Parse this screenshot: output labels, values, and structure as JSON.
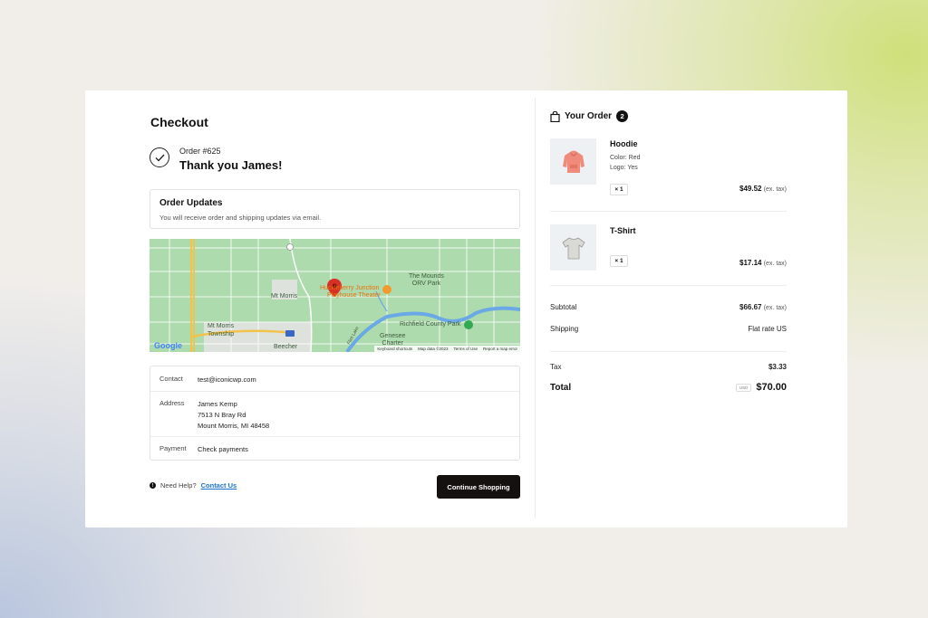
{
  "checkout": {
    "title": "Checkout",
    "order_number": "Order #625",
    "thank_you": "Thank you James!"
  },
  "updates": {
    "heading": "Order Updates",
    "text": "You will receive order and shipping updates via email."
  },
  "map": {
    "labels": {
      "mt_morris": "Mt Morris",
      "mt_morris_township": "Mt Morris Township",
      "beecher": "Beecher",
      "theater_line1": "Huckleberry Junction",
      "theater_line2": "Playhouse Theater",
      "mounds_line1": "The Mounds",
      "mounds_line2": "ORV Park",
      "richfield": "Richfield County Park",
      "genesee_line1": "Genesee",
      "genesee_line2": "Charter",
      "flint_lake": "Flint Lake"
    },
    "google": "Google",
    "attribution": {
      "shortcuts": "Keyboard shortcuts",
      "map_data": "Map data ©2023",
      "terms": "Terms of Use",
      "report": "Report a map error"
    }
  },
  "details": {
    "contact_label": "Contact",
    "contact_value": "test@iconicwp.com",
    "address_label": "Address",
    "address_line1": "James Kemp",
    "address_line2": "7513 N Bray Rd",
    "address_line3": "Mount Morris, MI 48458",
    "payment_label": "Payment",
    "payment_value": "Check payments"
  },
  "help": {
    "text": "Need Help?",
    "link": "Contact Us"
  },
  "continue_button": "Continue Shopping",
  "order": {
    "title": "Your Order",
    "count": "2",
    "items": [
      {
        "name": "Hoodie",
        "meta1": "Color: Red",
        "meta2": "Logo: Yes",
        "qty": "× 1",
        "price": "$49.52",
        "ex_tax": "(ex. tax)"
      },
      {
        "name": "T-Shirt",
        "qty": "× 1",
        "price": "$17.14",
        "ex_tax": "(ex. tax)"
      }
    ],
    "subtotal_label": "Subtotal",
    "subtotal_value": "$66.67",
    "subtotal_ex": "(ex. tax)",
    "shipping_label": "Shipping",
    "shipping_value": "Flat rate US",
    "tax_label": "Tax",
    "tax_value": "$3.33",
    "total_label": "Total",
    "currency": "USD",
    "total_value": "$70.00"
  },
  "colors": {
    "button_bg": "#15110f",
    "link": "#1a73c8",
    "map_pin": "#d93025",
    "hoodie": "#f08a7a"
  }
}
